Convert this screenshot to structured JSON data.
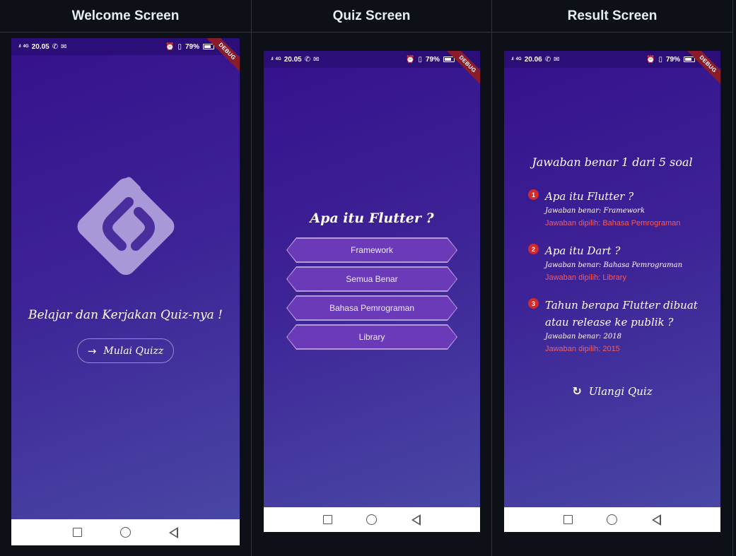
{
  "headers": {
    "welcome": "Welcome Screen",
    "quiz": "Quiz Screen",
    "result": "Result Screen"
  },
  "status": {
    "welcome_time": "20.05",
    "quiz_time": "20.05",
    "result_time": "20.06",
    "network": "4G",
    "battery": "79%",
    "debug_banner": "DEBUG"
  },
  "welcome": {
    "tagline": "Belajar dan Kerjakan Quiz-nya !",
    "start_button": "Mulai Quizz",
    "logo_icon": "brand-logo-icon"
  },
  "quiz": {
    "question": "Apa itu Flutter ?",
    "answers": [
      "Framework",
      "Semua Benar",
      "Bahasa Pemrograman",
      "Library"
    ]
  },
  "result": {
    "score": "Jawaban benar 1 dari 5 soal",
    "items": [
      {
        "num": "1",
        "question": "Apa itu Flutter ?",
        "correct": "Jawaban benar: Framework",
        "picked": "Jawaban dipilih: Bahasa Pemrograman"
      },
      {
        "num": "2",
        "question": "Apa itu Dart ?",
        "correct": "Jawaban benar: Bahasa Pemrograman",
        "picked": "Jawaban dipilih: Library"
      },
      {
        "num": "3",
        "question": "Tahun berapa Flutter dibuat atau release ke publik ?",
        "correct": "Jawaban benar: 2018",
        "picked": "Jawaban dipilih: 2015"
      }
    ],
    "retry_button": "Ulangi Quiz"
  },
  "colors": {
    "bg": "#0d1117",
    "gradient_top": "#35118c",
    "gradient_bottom": "#4a4aa6",
    "wrong": "#ff5a4f",
    "badge": "#d42a2a",
    "answer_fill": "#6a3ab8"
  }
}
